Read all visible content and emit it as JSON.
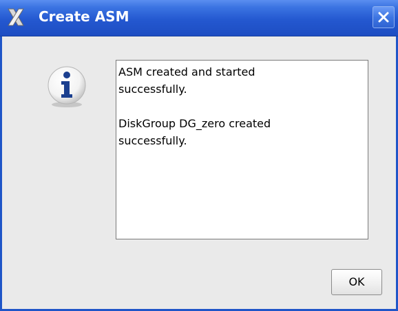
{
  "window": {
    "title": "Create ASM",
    "title_bar_color": "#2458d0"
  },
  "message": {
    "text": "ASM created and started\nsuccessfully.\n\nDiskGroup DG_zero created\nsuccessfully."
  },
  "icons": {
    "app": "app-x-icon",
    "info": "info-icon",
    "close": "close-icon"
  },
  "buttons": {
    "ok_label": "OK"
  }
}
